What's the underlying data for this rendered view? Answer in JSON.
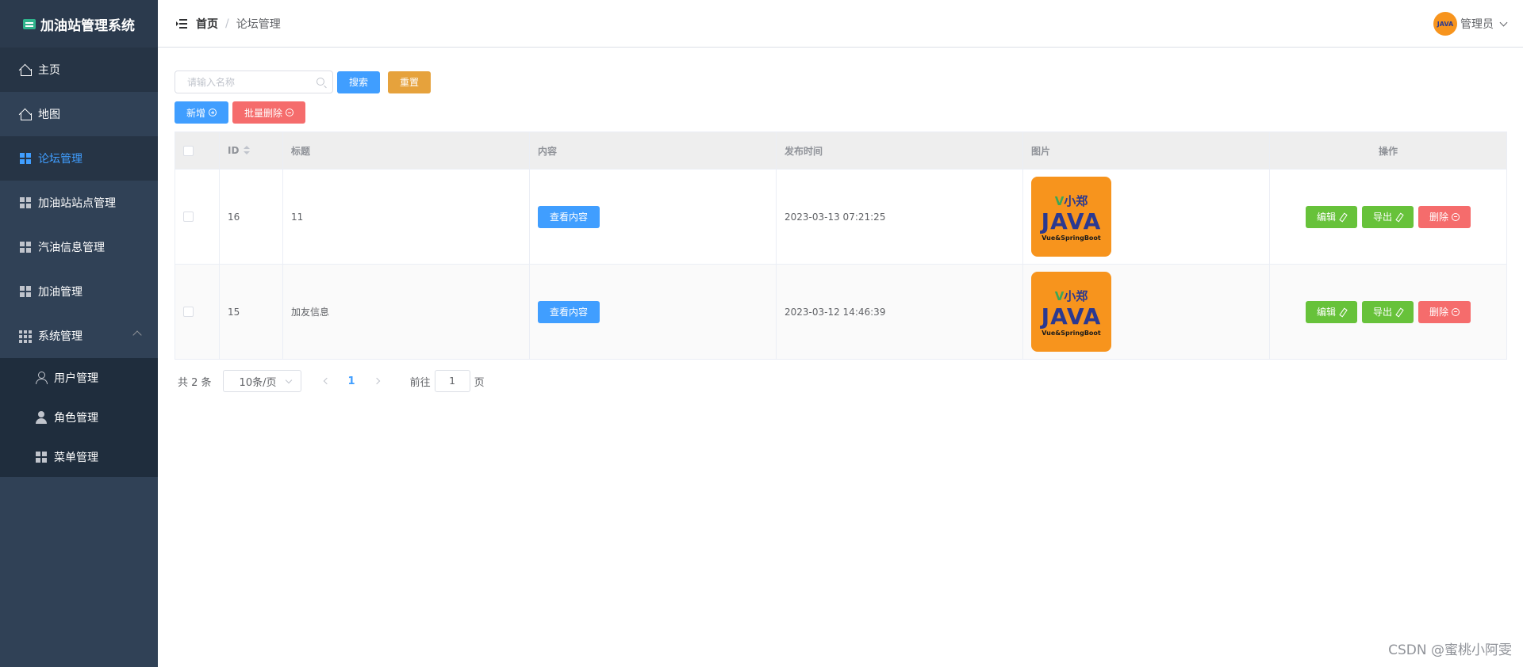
{
  "app": {
    "title": "加油站管理系统"
  },
  "sidebar": {
    "items": [
      {
        "label": "主页",
        "icon": "home-icon"
      },
      {
        "label": "地图",
        "icon": "home-icon"
      },
      {
        "label": "论坛管理",
        "icon": "grid-icon",
        "active": true
      },
      {
        "label": "加油站站点管理",
        "icon": "grid-icon"
      },
      {
        "label": "汽油信息管理",
        "icon": "grid-icon"
      },
      {
        "label": "加油管理",
        "icon": "grid-icon"
      },
      {
        "label": "系统管理",
        "icon": "grid9-icon",
        "expanded": true
      }
    ],
    "subitems": [
      {
        "label": "用户管理",
        "icon": "user-icon"
      },
      {
        "label": "角色管理",
        "icon": "user-filled-icon"
      },
      {
        "label": "菜单管理",
        "icon": "grid-icon"
      }
    ]
  },
  "header": {
    "breadcrumb": [
      "首页",
      "论坛管理"
    ],
    "breadcrumb_sep": "/",
    "user_name": "管理员",
    "avatar_text": "JAVA"
  },
  "toolbar": {
    "search_placeholder": "请输入名称",
    "search_label": "搜索",
    "reset_label": "重置",
    "add_label": "新增",
    "batch_delete_label": "批量删除"
  },
  "table": {
    "columns": {
      "id": "ID",
      "title": "标题",
      "content": "内容",
      "time": "发布时间",
      "image": "图片",
      "ops": "操作"
    },
    "view_content_label": "查看内容",
    "edit_label": "编辑",
    "export_label": "导出",
    "delete_label": "删除",
    "thumb": {
      "line1": "小郑",
      "line2": "JAVA",
      "line3": "Vue&SpringBoot"
    },
    "rows": [
      {
        "id": "16",
        "title": "11",
        "time": "2023-03-13 07:21:25"
      },
      {
        "id": "15",
        "title": "加友信息",
        "time": "2023-03-12 14:46:39"
      }
    ]
  },
  "pagination": {
    "total": "共 2 条",
    "page_size": "10条/页",
    "current_page": "1",
    "goto_prefix": "前往",
    "goto_value": "1",
    "goto_suffix": "页"
  },
  "watermark": "CSDN @蜜桃小阿雯",
  "colors": {
    "sidebar_bg": "#304156",
    "primary": "#409eff",
    "success": "#67c23a",
    "warning": "#e6a23c",
    "danger": "#f56c6c"
  }
}
